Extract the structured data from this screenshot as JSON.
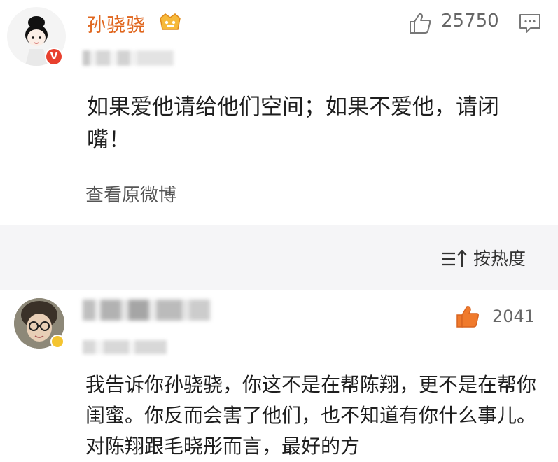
{
  "post": {
    "author": "孙骁骁",
    "verified_badge": "V",
    "member_icon": "crown-icon",
    "likes": "25750",
    "text": "如果爱他请给他们空间；如果不爱他，请闭嘴！",
    "view_original": "查看原微博"
  },
  "comments_header": {
    "sort_label": "按热度"
  },
  "comment": {
    "likes": "2041",
    "text": "我告诉你孙骁骁，你这不是在帮陈翔，更不是在帮你闺蜜。你反而会害了他们，也不知道有你什么事儿。对陈翔跟毛晓彤而言，最好的方"
  },
  "colors": {
    "author_name": "#e0661e",
    "like_accent": "#f07a2c",
    "verified": "#e8402e"
  }
}
